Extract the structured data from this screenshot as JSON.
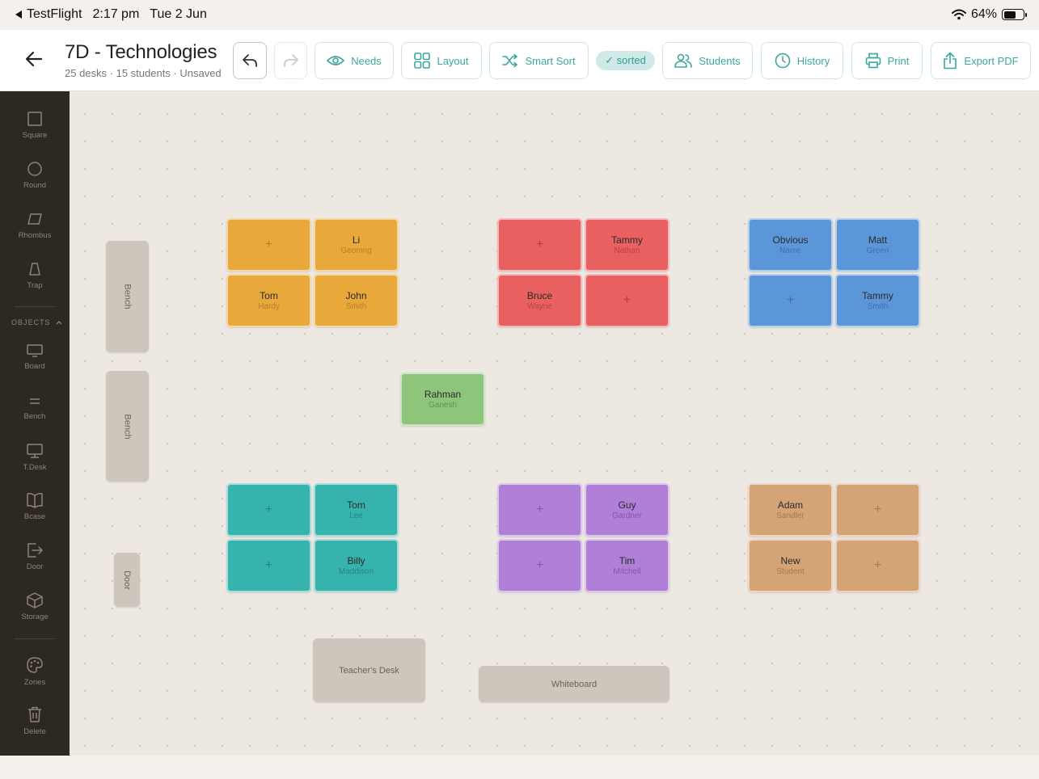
{
  "status_bar": {
    "back_app": "TestFlight",
    "time": "2:17 pm",
    "date": "Tue 2 Jun",
    "battery_text": "64%",
    "battery_level": 0.64
  },
  "header": {
    "title": "7D - Technologies",
    "subtitle": "25 desks · 15 students · Unsaved",
    "buttons": {
      "needs": "Needs",
      "layout": "Layout",
      "smart_sort": "Smart Sort",
      "sorted_badge": "✓ sorted",
      "students": "Students",
      "history": "History",
      "print": "Print",
      "export_pdf": "Export PDF"
    }
  },
  "sidebar": {
    "tools": {
      "square": "Square",
      "round": "Round",
      "rhombus": "Rhombus",
      "trap": "Trap"
    },
    "objects_header": "OBJECTS",
    "objects": {
      "board": "Board",
      "bench": "Bench",
      "tdesk": "T.Desk",
      "bcase": "Bcase",
      "door": "Door",
      "storage": "Storage"
    },
    "zones": "Zones",
    "delete": "Delete"
  },
  "colors": {
    "accent": "#3aa79d",
    "yellow": "#e8a83a",
    "red": "#e86060",
    "blue": "#5b97d8",
    "green": "#8dc67a",
    "teal": "#35b3ac",
    "purple": "#b07fd8",
    "tan": "#d4a476"
  },
  "canvas": {
    "groups": {
      "yellow": [
        {
          "first": "",
          "last": "",
          "empty": true,
          "plus": "+"
        },
        {
          "first": "Li",
          "last": "Geomng",
          "empty": false
        },
        {
          "first": "Tom",
          "last": "Hardy",
          "empty": false
        },
        {
          "first": "John",
          "last": "Smith",
          "empty": false
        }
      ],
      "red": [
        {
          "first": "",
          "last": "",
          "empty": true,
          "plus": "+"
        },
        {
          "first": "Tammy",
          "last": "Nathan",
          "empty": false
        },
        {
          "first": "Bruce",
          "last": "Wayne",
          "empty": false
        },
        {
          "first": "",
          "last": "",
          "empty": true,
          "plus": "+"
        }
      ],
      "blue": [
        {
          "first": "Obvious",
          "last": "Name",
          "empty": false
        },
        {
          "first": "Matt",
          "last": "Green",
          "empty": false
        },
        {
          "first": "",
          "last": "",
          "empty": true,
          "plus": "+"
        },
        {
          "first": "Tammy",
          "last": "Smith",
          "empty": false
        }
      ],
      "green": [
        {
          "first": "Rahman",
          "last": "Ganesh",
          "empty": false
        }
      ],
      "teal": [
        {
          "first": "",
          "last": "",
          "empty": true,
          "plus": "+"
        },
        {
          "first": "Tom",
          "last": "Lee",
          "empty": false
        },
        {
          "first": "",
          "last": "",
          "empty": true,
          "plus": "+"
        },
        {
          "first": "Billy",
          "last": "Maddison",
          "empty": false
        }
      ],
      "purple": [
        {
          "first": "",
          "last": "",
          "empty": true,
          "plus": "+"
        },
        {
          "first": "Guy",
          "last": "Gardner",
          "empty": false
        },
        {
          "first": "",
          "last": "",
          "empty": true,
          "plus": "+"
        },
        {
          "first": "Tim",
          "last": "Mitchell",
          "empty": false
        }
      ],
      "tan": [
        {
          "first": "Adam",
          "last": "Sandler",
          "empty": false
        },
        {
          "first": "",
          "last": "",
          "empty": true,
          "plus": "+"
        },
        {
          "first": "New",
          "last": "Student",
          "empty": false
        },
        {
          "first": "",
          "last": "",
          "empty": true,
          "plus": "+"
        }
      ]
    },
    "objects": {
      "bench_1": "Bench",
      "bench_2": "Bench",
      "door": "Door",
      "teachers_desk": "Teacher's Desk",
      "whiteboard": "Whiteboard"
    }
  }
}
